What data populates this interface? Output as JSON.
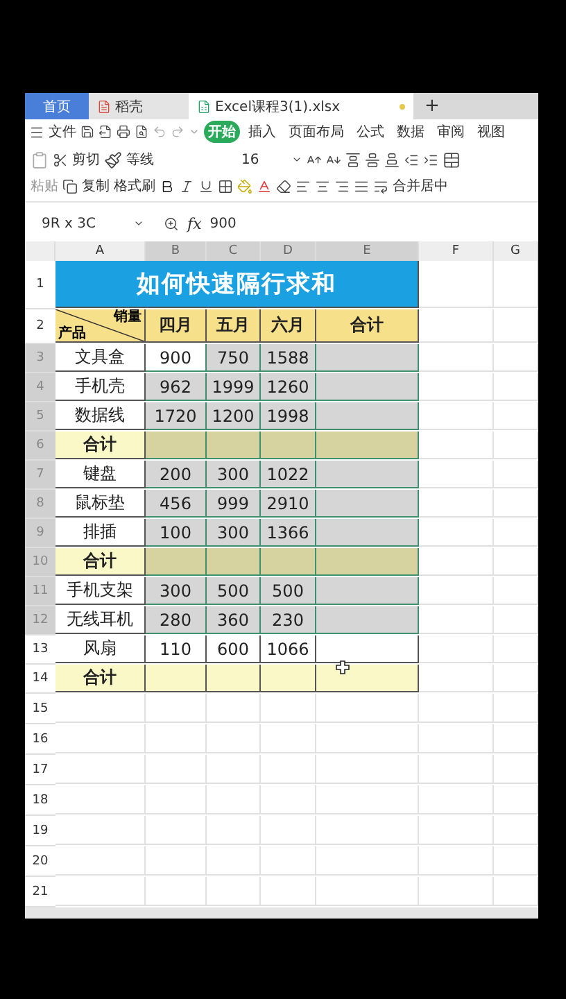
{
  "tabs": [
    {
      "label": "首页",
      "kind": "home",
      "selected": false
    },
    {
      "label": "稻壳",
      "kind": "docer",
      "selected": false
    },
    {
      "label": "Excel课程3(1).xlsx",
      "kind": "sheet",
      "selected": true
    }
  ],
  "new_tab": "+",
  "menu": {
    "file": "文件",
    "ribbon_tabs": [
      {
        "label": "开始",
        "selected": true
      },
      {
        "label": "插入",
        "selected": false
      },
      {
        "label": "页面布局",
        "selected": false
      },
      {
        "label": "公式",
        "selected": false
      },
      {
        "label": "数据",
        "selected": false
      },
      {
        "label": "审阅",
        "selected": false
      },
      {
        "label": "视图",
        "selected": false
      }
    ]
  },
  "toolbar": {
    "paste": "粘贴",
    "cut": "剪切",
    "copy": "复制",
    "format_painter": "格式刷",
    "font": "等线",
    "size": "16",
    "merge": "合并居中"
  },
  "formula_bar": {
    "name_box": "9R x 3C",
    "fx": "fx",
    "value": "900"
  },
  "sheet": {
    "columns": [
      {
        "label": "A",
        "selected": false
      },
      {
        "label": "B",
        "selected": true
      },
      {
        "label": "C",
        "selected": true
      },
      {
        "label": "D",
        "selected": true
      },
      {
        "label": "E",
        "selected": true
      },
      {
        "label": "F",
        "selected": false
      },
      {
        "label": "G",
        "selected": false
      }
    ],
    "title_row": "1",
    "title": "如何快速隔行求和",
    "header_row": "2",
    "diagonal_top": "销量",
    "diagonal_bottom": "产品",
    "months": [
      "四月",
      "五月",
      "六月"
    ],
    "total": "合计",
    "rows": [
      {
        "number": "3",
        "kind": "data",
        "selected": true,
        "product": "文具盒",
        "cells": [
          {
            "text": "900",
            "active": true
          },
          {
            "text": "750",
            "active": false
          },
          {
            "text": "1588",
            "active": false
          }
        ]
      },
      {
        "number": "4",
        "kind": "data",
        "selected": true,
        "product": "手机壳",
        "cells": [
          {
            "text": "962",
            "active": false
          },
          {
            "text": "1999",
            "active": false
          },
          {
            "text": "1260",
            "active": false
          }
        ]
      },
      {
        "number": "5",
        "kind": "data",
        "selected": true,
        "product": "数据线",
        "cells": [
          {
            "text": "1720",
            "active": false
          },
          {
            "text": "1200",
            "active": false
          },
          {
            "text": "1998",
            "active": false
          }
        ]
      },
      {
        "number": "6",
        "kind": "total",
        "selected": true,
        "product": "合计"
      },
      {
        "number": "7",
        "kind": "data",
        "selected": true,
        "product": "键盘",
        "cells": [
          {
            "text": "200",
            "active": false
          },
          {
            "text": "300",
            "active": false
          },
          {
            "text": "1022",
            "active": false
          }
        ]
      },
      {
        "number": "8",
        "kind": "data",
        "selected": true,
        "product": "鼠标垫",
        "cells": [
          {
            "text": "456",
            "active": false
          },
          {
            "text": "999",
            "active": false
          },
          {
            "text": "2910",
            "active": false
          }
        ]
      },
      {
        "number": "9",
        "kind": "data",
        "selected": true,
        "product": "排插",
        "cells": [
          {
            "text": "100",
            "active": false
          },
          {
            "text": "300",
            "active": false
          },
          {
            "text": "1366",
            "active": false
          }
        ]
      },
      {
        "number": "10",
        "kind": "total",
        "selected": true,
        "product": "合计"
      },
      {
        "number": "11",
        "kind": "data",
        "selected": true,
        "product": "手机支架",
        "cells": [
          {
            "text": "300",
            "active": false
          },
          {
            "text": "500",
            "active": false
          },
          {
            "text": "500",
            "active": false
          }
        ]
      },
      {
        "number": "12",
        "kind": "data",
        "selected": true,
        "product": "无线耳机",
        "cells": [
          {
            "text": "280",
            "active": false
          },
          {
            "text": "360",
            "active": false
          },
          {
            "text": "230",
            "active": false
          }
        ]
      },
      {
        "number": "13",
        "kind": "data",
        "selected": false,
        "product": "风扇",
        "cells": [
          {
            "text": "110",
            "active": false
          },
          {
            "text": "600",
            "active": false
          },
          {
            "text": "1066",
            "active": false
          }
        ]
      },
      {
        "number": "14",
        "kind": "total",
        "selected": false,
        "product": "合计"
      }
    ],
    "empty_rows": [
      "15",
      "16",
      "17",
      "18",
      "19",
      "20",
      "21"
    ]
  }
}
